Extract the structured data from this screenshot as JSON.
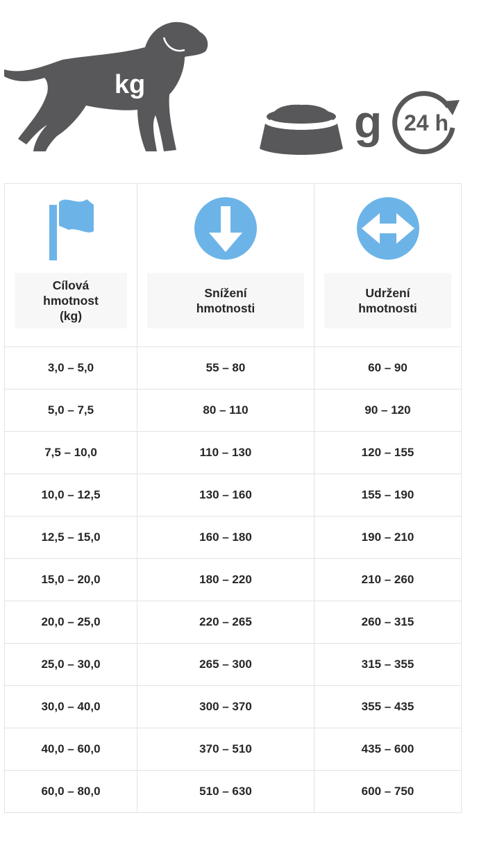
{
  "header": {
    "dog_badge": "kg",
    "grams_label": "g",
    "period_badge": "24 h",
    "icons": [
      "dog-icon",
      "food-bowl-icon",
      "24h-clock-icon"
    ]
  },
  "table": {
    "columns": [
      {
        "label": "Cílová\nhmotnost\n(kg)",
        "icon": "flag-icon"
      },
      {
        "label": "Snížení\nhmotnosti",
        "icon": "arrow-down-circle-icon"
      },
      {
        "label": "Udržení\nhmotnosti",
        "icon": "arrow-left-right-circle-icon"
      }
    ],
    "rows": [
      [
        "3,0 – 5,0",
        "55 – 80",
        "60 – 90"
      ],
      [
        "5,0 – 7,5",
        "80 – 110",
        "90 – 120"
      ],
      [
        "7,5 – 10,0",
        "110 – 130",
        "120 – 155"
      ],
      [
        "10,0 – 12,5",
        "130 – 160",
        "155 – 190"
      ],
      [
        "12,5 – 15,0",
        "160 – 180",
        "190 – 210"
      ],
      [
        "15,0 – 20,0",
        "180 – 220",
        "210 – 260"
      ],
      [
        "20,0 – 25,0",
        "220 – 265",
        "260 – 315"
      ],
      [
        "25,0 – 30,0",
        "265 – 300",
        "315 – 355"
      ],
      [
        "30,0 – 40,0",
        "300 – 370",
        "355 – 435"
      ],
      [
        "40,0 – 60,0",
        "370 – 510",
        "435 – 600"
      ],
      [
        "60,0 – 80,0",
        "510 – 630",
        "600 – 750"
      ]
    ]
  },
  "colors": {
    "icon_gray": "#58585a",
    "accent_blue": "#6cb4e8",
    "border": "#e2e2e2"
  }
}
